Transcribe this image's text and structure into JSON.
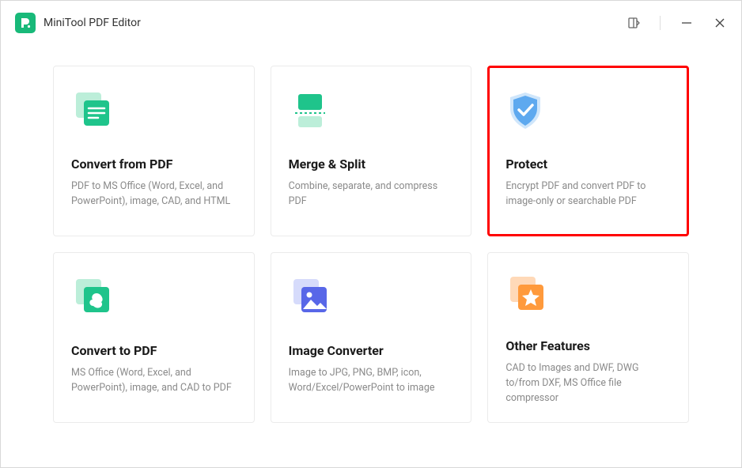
{
  "header": {
    "title": "MiniTool PDF Editor"
  },
  "cards": [
    {
      "title": "Convert from PDF",
      "desc": "PDF to MS Office (Word, Excel, and PowerPoint), image, CAD, and HTML"
    },
    {
      "title": "Merge & Split",
      "desc": "Combine, separate, and compress PDF"
    },
    {
      "title": "Protect",
      "desc": "Encrypt PDF and convert PDF to image-only or searchable PDF"
    },
    {
      "title": "Convert to PDF",
      "desc": "MS Office (Word, Excel, and PowerPoint), image, and CAD to PDF"
    },
    {
      "title": "Image Converter",
      "desc": "Image to JPG, PNG, BMP, icon, Word/Excel/PowerPoint to image"
    },
    {
      "title": "Other Features",
      "desc": "CAD to Images and DWF, DWG to/from DXF, MS Office file compressor"
    }
  ]
}
